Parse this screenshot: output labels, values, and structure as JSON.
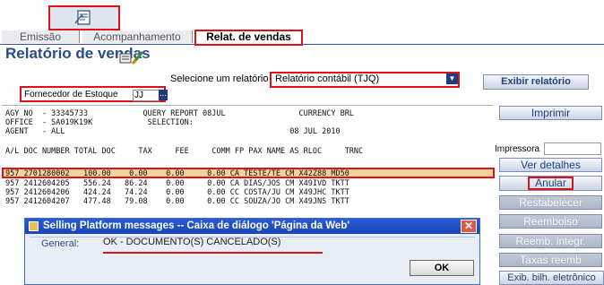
{
  "tabs": [
    {
      "label": "Emissão",
      "active": false
    },
    {
      "label": "Acompanhamento",
      "active": false
    },
    {
      "label": "Relat. de vendas",
      "active": true
    }
  ],
  "page": {
    "title": "Relatório de vendas"
  },
  "report": {
    "select_label": "Selecione um relatório",
    "selected": "Relatório contábil (TJQ)",
    "exibir_button": "Exibir relatório"
  },
  "fornecedor": {
    "label": "Fornecedor de Estoque",
    "value": "JJ",
    "lookup": "..."
  },
  "terminal": {
    "lines": [
      "AGY NO  - 33345733            QUERY REPORT 08JUL                CURRENCY BRL",
      "OFFICE  - SA019K19K            SELECTION:",
      "AGENT   - ALL                                                 08 JUL 2010",
      "",
      "A/L DOC NUMBER TOTAL DOC     TAX     FEE     COMM FP PAX NAME AS RLOC     TRNC",
      "",
      "957 2701280002   100.00    0.00    0.00     0.00 CA TESTE/TE CM X42Z88 MD50",
      "957 2412604205   556.24   86.24    0.00     0.00 CA DIAS/JOS CM X49IVD TKTT",
      "957 2412604206   424.24   74.24    0.00     0.00 CC COSTA/JU CM X49JHC TKTT",
      "957 2412604207   477.48   79.08    0.00     0.00 CC SOUZA/JO CM X49JNS TKTT"
    ]
  },
  "side": {
    "imprimir": "Imprimir",
    "impressora_label": "Impressora",
    "impressora_value": "",
    "ver_detalhes": "Ver detalhes",
    "anular": "Anular",
    "restabelecer": "Restabelecer",
    "reembolso": "Reembolso",
    "reemb_integr": "Reemb. integr.",
    "taxas_reemb": "Taxas reemb",
    "exib_bilh": "Exib. bilh. eletrônico"
  },
  "dialog": {
    "title": "Selling Platform messages -- Caixa de diálogo 'Página da Web'",
    "general_label": "General:",
    "message": "OK - DOCUMENTO(S) CANCELADO(S)",
    "ok": "OK",
    "close": "✕"
  },
  "colors": {
    "accent": "#2a4c86",
    "highlight_row": "#f1d29c",
    "red_box": "#d8141a",
    "dialog_title": "#2b5bd4"
  }
}
